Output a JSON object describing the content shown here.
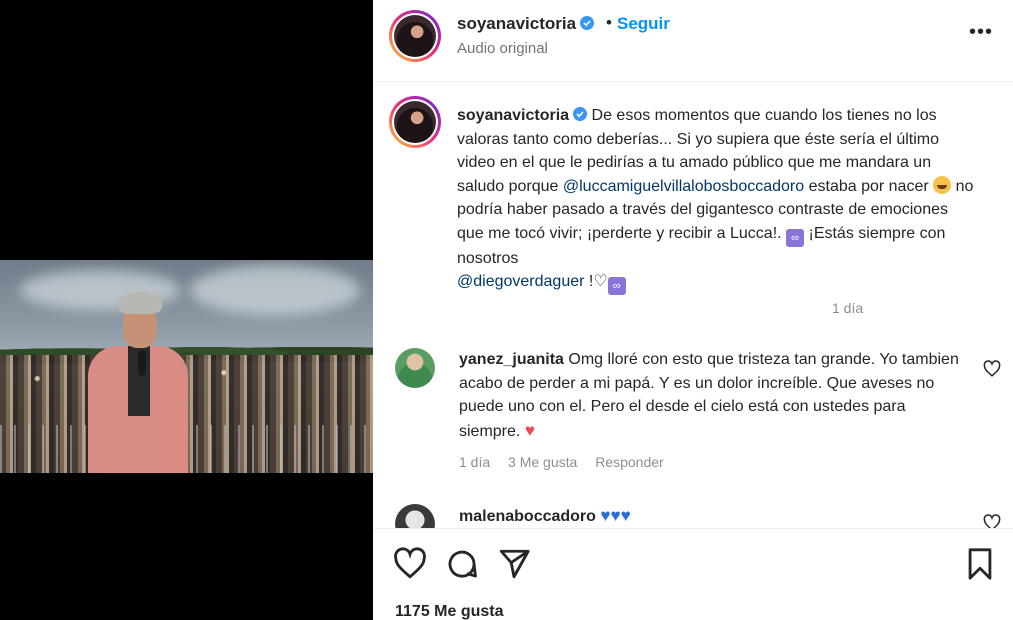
{
  "post": {
    "username": "soyanavictoria",
    "follow_label": "Seguir",
    "separator": "•",
    "audio_label": "Audio original",
    "more_label": "•••"
  },
  "caption": {
    "username": "soyanavictoria",
    "text_1": "De esos momentos que cuando los tienes no los valoras tanto como deberías... Si yo supiera que éste sería el último video en el que le pedirías a tu amado público que me mandara un saludo porque",
    "mention_1": "@luccamiguelvillalobosboccadoro",
    "text_2": "estaba por nacer",
    "text_3": "no podría haber pasado a través del gigantesco contraste de emociones que me tocó vivir; ¡perderte y recibir a Lucca!.",
    "text_4": "¡Estás siempre con nosotros",
    "mention_2": "@diegoverdaguer",
    "text_5": "!♡",
    "time": "1 día"
  },
  "comments": [
    {
      "username": "yanez_juanita",
      "text": "Omg lloré con esto que tristeza tan grande. Yo tambien acabo de perder a mi papá. Y es un dolor increíble. Que aveses no puede uno con el. Pero el desde el cielo está con ustedes para siempre.",
      "emoji": "♥",
      "time": "1 día",
      "likes": "3 Me gusta",
      "reply": "Responder"
    },
    {
      "username": "malenaboccadoro",
      "emoji": "♥♥♥"
    }
  ],
  "footer": {
    "likes": "1175 Me gusta"
  },
  "colors": {
    "accent": "#0095f6",
    "mention": "#00376b",
    "verified": "#3897f0",
    "heart": "#ed4956"
  }
}
